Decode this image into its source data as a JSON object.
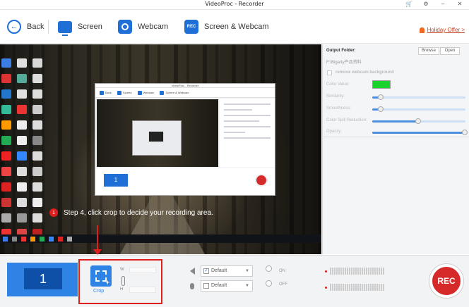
{
  "window": {
    "title": "VideoProc - Recorder"
  },
  "toolbar": {
    "back_label": "Back",
    "screen_label": "Screen",
    "webcam_label": "Webcam",
    "screen_webcam_label": "Screen & Webcam",
    "rec_icon_text": "REC",
    "offer_label": "Holiday Offer >"
  },
  "annotation": {
    "step_number": "1",
    "step_text": "Step 4, click crop to decide your recording area."
  },
  "settings": {
    "output_folder_label": "Output Folder:",
    "output_path": "F:\\Bigarty产品资料",
    "browse_label": "Browse",
    "open_label": "Open",
    "remove_bg_label": "remove webcam background",
    "color_value_label": "Color Value:",
    "color_value": "#19d22b",
    "similarity_label": "Similarity:",
    "smoothness_label": "Smoothness:",
    "color_spill_label": "Color Spill Reduction:",
    "opacity_label": "Opacity:",
    "similarity_level": 0.1,
    "smoothness_level": 0.1,
    "color_spill_level": 0.5,
    "opacity_level": 1.0
  },
  "inner_window": {
    "title": "VideoProc - Recorder",
    "back": "Back",
    "screen": "Screen",
    "webcam": "Webcam",
    "screen_webcam": "Screen & Webcam",
    "monitor": "1"
  },
  "bottom": {
    "monitor_number": "1",
    "crop_label": "Crop",
    "w_label": "W",
    "h_label": "H",
    "speaker_device": "Default",
    "mic_device": "Default",
    "on_label": "ON",
    "off_label": "OFF",
    "rec_label": "REC"
  },
  "colors": {
    "accent": "#2f83e5",
    "record": "#d62a2a",
    "highlight": "#e01e1e"
  }
}
